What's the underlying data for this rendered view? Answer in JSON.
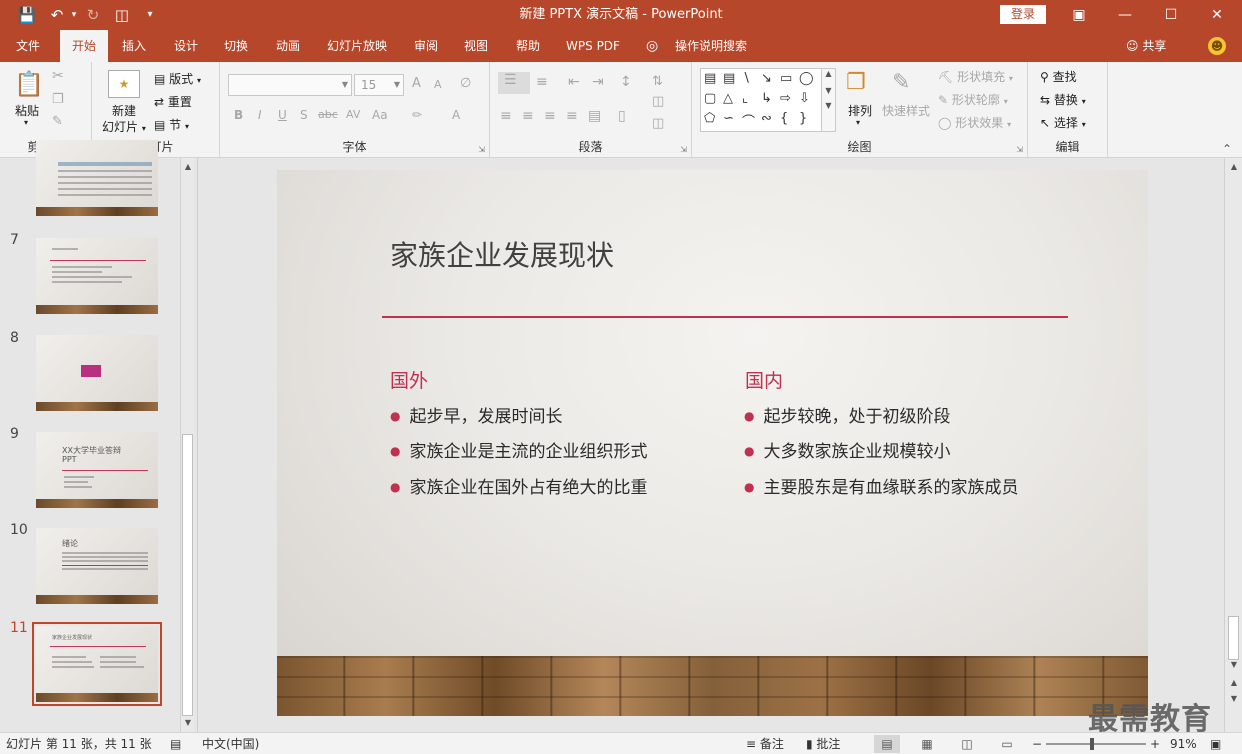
{
  "app": {
    "title": "新建 PPTX 演示文稿 - PowerPoint",
    "login": "登录",
    "quick_access": [
      "save-icon",
      "undo-icon",
      "redo-icon",
      "start-presentation-icon",
      "customize-icon"
    ],
    "window_controls": [
      "ribbon-display-icon",
      "minimize-icon",
      "maximize-icon",
      "close-icon"
    ]
  },
  "tabs": [
    "文件",
    "开始",
    "插入",
    "设计",
    "切换",
    "动画",
    "幻灯片放映",
    "审阅",
    "视图",
    "帮助",
    "WPS PDF",
    "操作说明搜索"
  ],
  "active_tab": "开始",
  "share": "共享",
  "ribbon": {
    "clipboard": {
      "label": "剪贴板",
      "paste": "粘贴"
    },
    "slides": {
      "label": "幻灯片",
      "new_slide_line1": "新建",
      "new_slide_line2": "幻灯片",
      "layout": "版式",
      "reset": "重置",
      "section": "节"
    },
    "font": {
      "label": "字体",
      "font_name": "",
      "font_size": "15",
      "bold": "B",
      "italic": "I",
      "underline": "U",
      "strike": "abc",
      "shadow": "S",
      "case": "Aa",
      "grow": "A",
      "shrink": "A"
    },
    "paragraph": {
      "label": "段落"
    },
    "drawing": {
      "label": "绘图",
      "arrange": "排列",
      "quick_styles": "快速样式",
      "shape_fill": "形状填充",
      "shape_outline": "形状轮廓",
      "shape_effects": "形状效果"
    },
    "editing": {
      "label": "编辑",
      "find": "查找",
      "replace": "替换",
      "select": "选择"
    }
  },
  "thumbnails": {
    "numbers": [
      "7",
      "8",
      "9",
      "10",
      "11"
    ],
    "slide9_title": "XX大学毕业答辩PPT",
    "slide10_title": "绪论",
    "slide11_title": "家族企业发展现状",
    "active": "11"
  },
  "slide": {
    "title": "家族企业发展现状",
    "left_heading": "国外",
    "left_bullets": [
      "起步早，发展时间长",
      "家族企业是主流的企业组织形式",
      "家族企业在国外占有绝大的比重"
    ],
    "right_heading": "国内",
    "right_bullets": [
      "起步较晚，处于初级阶段",
      "大多数家族企业规模较小",
      "主要股东是有血缘联系的家族成员"
    ]
  },
  "watermark": "最需教育",
  "status": {
    "slide_info": "幻灯片 第 11 张，共 11 张",
    "language": "中文(中国)",
    "notes": "备注",
    "comments": "批注",
    "zoom": "91%",
    "zoom_level": 0.91
  },
  "colors": {
    "brand": "#b7472a",
    "accent": "#c0304f"
  }
}
